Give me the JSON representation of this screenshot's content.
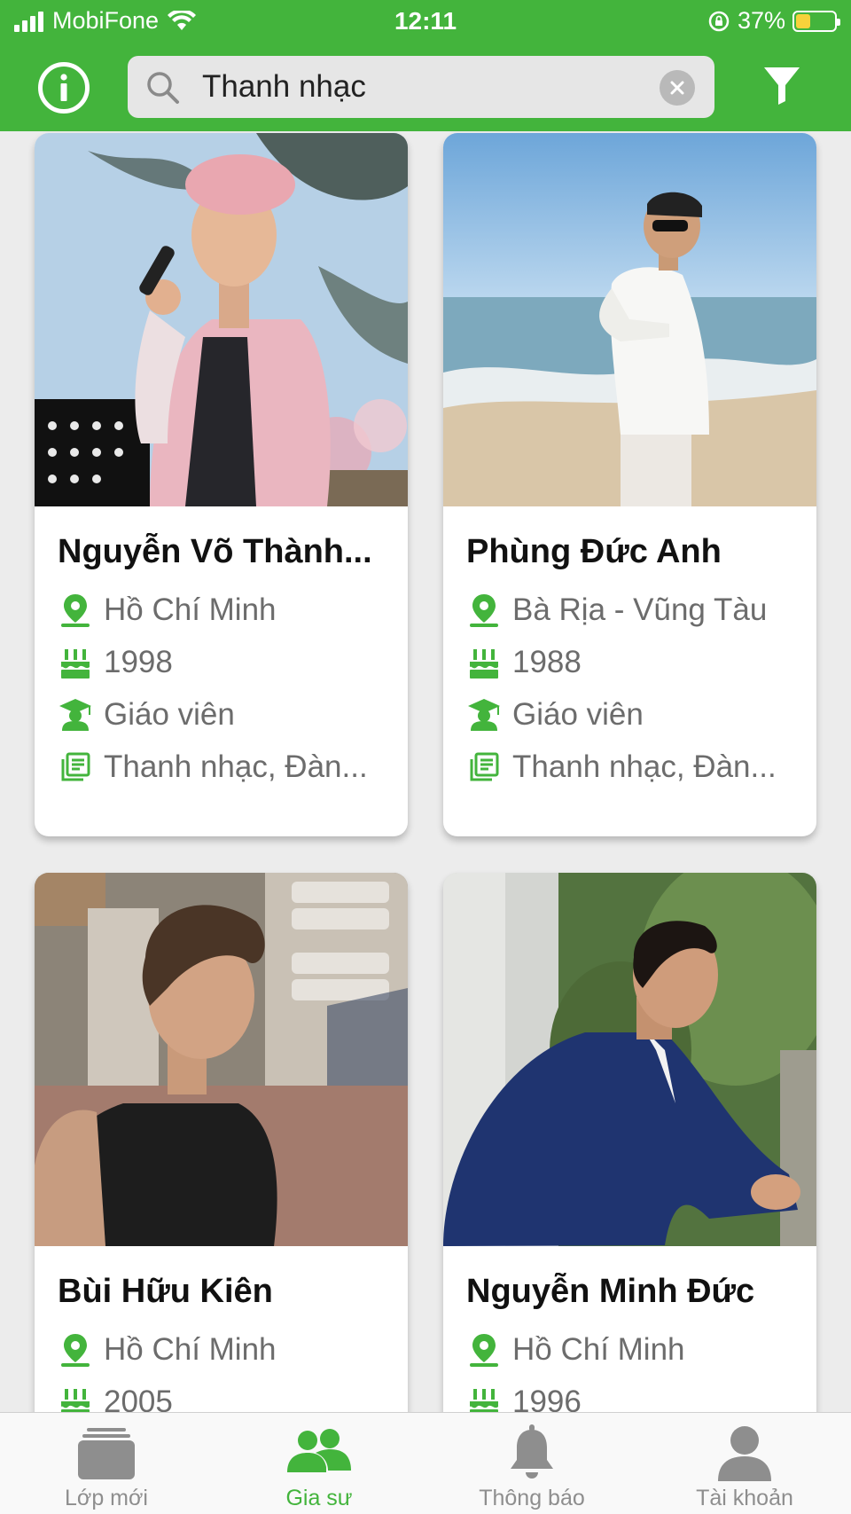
{
  "status_bar": {
    "carrier": "MobiFone",
    "time": "12:11",
    "battery_percent": "37%",
    "battery_level": 0.37
  },
  "search": {
    "value": "Thanh nhạc"
  },
  "tutors": [
    {
      "name": "Nguyễn Võ Thành...",
      "location": "Hồ Chí Minh",
      "birth_year": "1998",
      "role": "Giáo viên",
      "subjects": "Thanh nhạc, Đàn..."
    },
    {
      "name": "Phùng Đức Anh",
      "location": "Bà Rịa - Vũng Tàu",
      "birth_year": "1988",
      "role": "Giáo viên",
      "subjects": "Thanh nhạc, Đàn..."
    },
    {
      "name": "Bùi Hữu Kiên",
      "location": "Hồ Chí Minh",
      "birth_year": "2005"
    },
    {
      "name": "Nguyễn Minh Đức",
      "location": "Hồ Chí Minh",
      "birth_year": "1996"
    }
  ],
  "bottom_nav": {
    "items": [
      {
        "label": "Lớp mới",
        "icon": "stack-icon"
      },
      {
        "label": "Gia sư",
        "icon": "people-icon",
        "active": true
      },
      {
        "label": "Thông báo",
        "icon": "bell-icon"
      },
      {
        "label": "Tài khoản",
        "icon": "user-icon"
      }
    ]
  },
  "colors": {
    "brand_green": "#43b43c",
    "inactive_gray": "#8e8e8e"
  }
}
